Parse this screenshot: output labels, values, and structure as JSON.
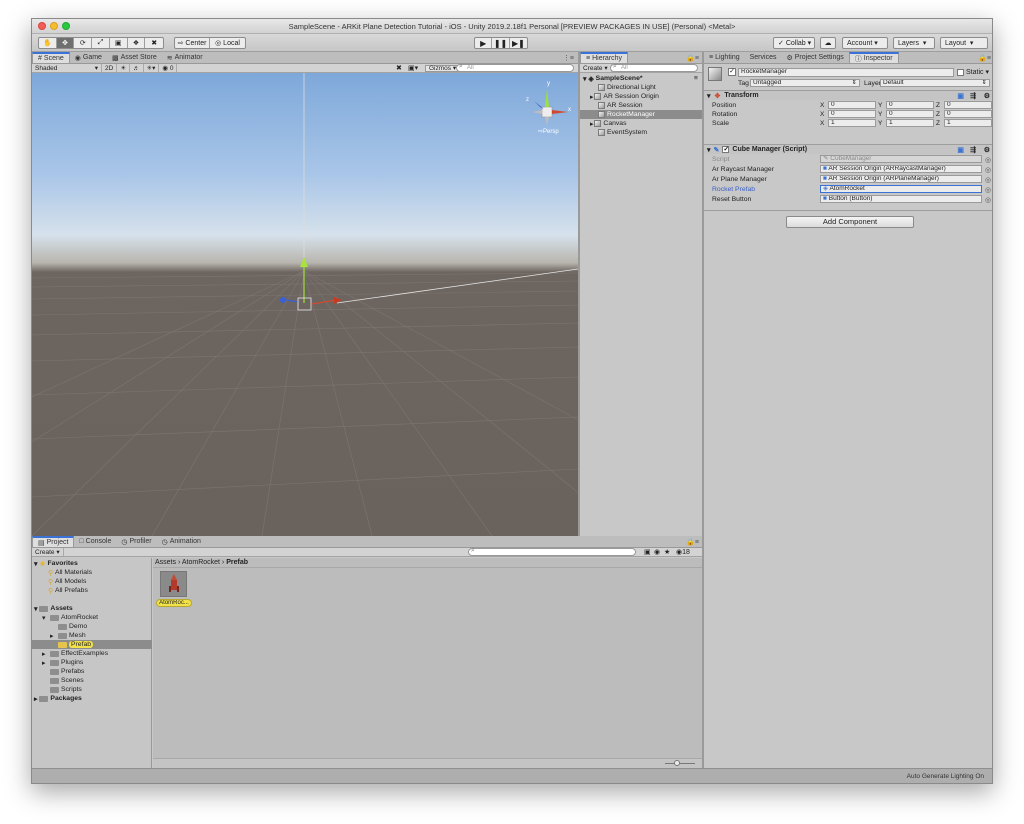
{
  "window": {
    "title": "SampleScene - ARKit Plane Detection Tutorial - iOS - Unity 2019.2.18f1 Personal [PREVIEW PACKAGES IN USE] (Personal) <Metal>"
  },
  "toolbar": {
    "tools": [
      "hand-tool",
      "move-tool",
      "rotate-tool",
      "scale-tool",
      "rect-tool",
      "transform-tool",
      "custom-tool"
    ],
    "pivot_center": "Center",
    "pivot_local": "Local",
    "collab": "Collab",
    "account": "Account",
    "layers": "Layers",
    "layout": "Layout"
  },
  "scene_tabs": [
    {
      "label": "Scene",
      "icon": "#"
    },
    {
      "label": "Game",
      "icon": "C"
    },
    {
      "label": "Asset Store",
      "icon": "≡"
    },
    {
      "label": "Animator",
      "icon": "≈"
    }
  ],
  "scene_bar": {
    "shading": "Shaded",
    "mode_2d": "2D",
    "gizmos": "Gizmos",
    "search_placeholder": "All",
    "layers_count": "0",
    "persp": "Persp",
    "gizmo_axis_y": "y",
    "gizmo_axis_x": "x",
    "gizmo_axis_z": "z"
  },
  "hierarchy": {
    "tab": "Hierarchy",
    "create": "Create",
    "search_placeholder": "All",
    "scene": "SampleScene*",
    "items": [
      {
        "label": "Directional Light",
        "expand": false,
        "indent": 2,
        "selected": false
      },
      {
        "label": "AR Session Origin",
        "expand": true,
        "indent": 2,
        "selected": false
      },
      {
        "label": "AR Session",
        "expand": false,
        "indent": 2,
        "selected": false
      },
      {
        "label": "RocketManager",
        "expand": false,
        "indent": 2,
        "selected": true
      },
      {
        "label": "Canvas",
        "expand": true,
        "indent": 2,
        "selected": false
      },
      {
        "label": "EventSystem",
        "expand": false,
        "indent": 2,
        "selected": false
      }
    ]
  },
  "right_tabs": [
    {
      "label": "Lighting"
    },
    {
      "label": "Services"
    },
    {
      "label": "Project Settings"
    },
    {
      "label": "Inspector"
    }
  ],
  "inspector": {
    "object_name": "RocketManager",
    "static": "Static",
    "tag_label": "Tag",
    "tag_value": "Untagged",
    "layer_label": "Layer",
    "layer_value": "Default",
    "transform": {
      "title": "Transform",
      "rows": [
        {
          "label": "Position",
          "x": "0",
          "y": "0",
          "z": "0"
        },
        {
          "label": "Rotation",
          "x": "0",
          "y": "0",
          "z": "0"
        },
        {
          "label": "Scale",
          "x": "1",
          "y": "1",
          "z": "1"
        }
      ]
    },
    "cube_manager": {
      "title": "Cube Manager (Script)",
      "rows": [
        {
          "label": "Script",
          "value": "CubeManager",
          "disabled": true
        },
        {
          "label": "Ar Raycast Manager",
          "value": "AR Session Origin (ARRaycastManager)",
          "disabled": false
        },
        {
          "label": "Ar Plane Manager",
          "value": "AR Session Origin (ARPlaneManager)",
          "disabled": false
        },
        {
          "label": "Rocket Prefab",
          "value": "AtomRocket",
          "disabled": false,
          "highlight": true
        },
        {
          "label": "Reset Button",
          "value": "Button (Button)",
          "disabled": false
        }
      ]
    },
    "add_component": "Add Component"
  },
  "project_tabs": [
    {
      "label": "Project"
    },
    {
      "label": "Console"
    },
    {
      "label": "Profiler"
    },
    {
      "label": "Animation"
    }
  ],
  "project": {
    "create": "Create",
    "count": "18",
    "favorites": "Favorites",
    "favorite_items": [
      "All Materials",
      "All Models",
      "All Prefabs"
    ],
    "assets": "Assets",
    "tree": [
      {
        "label": "AtomRocket",
        "indent": 1,
        "expand": "open",
        "selected": false
      },
      {
        "label": "Demo",
        "indent": 2,
        "expand": "none",
        "selected": false
      },
      {
        "label": "Mesh",
        "indent": 2,
        "expand": "closed",
        "selected": false
      },
      {
        "label": "Prefab",
        "indent": 2,
        "expand": "none",
        "selected": true
      },
      {
        "label": "EffectExamples",
        "indent": 1,
        "expand": "closed",
        "selected": false
      },
      {
        "label": "Plugins",
        "indent": 1,
        "expand": "closed",
        "selected": false
      },
      {
        "label": "Prefabs",
        "indent": 1,
        "expand": "none",
        "selected": false
      },
      {
        "label": "Scenes",
        "indent": 1,
        "expand": "none",
        "selected": false
      },
      {
        "label": "Scripts",
        "indent": 1,
        "expand": "none",
        "selected": false
      }
    ],
    "packages": "Packages",
    "breadcrumb": [
      "Assets",
      "AtomRocket",
      "Prefab"
    ],
    "asset_item": "AtomRoc..."
  },
  "status": {
    "text": "Auto Generate Lighting On"
  },
  "colors": {
    "accent": "#3a72d6",
    "selection_yellow": "#f2e24a",
    "hier_selected": "#8c8c8c"
  }
}
